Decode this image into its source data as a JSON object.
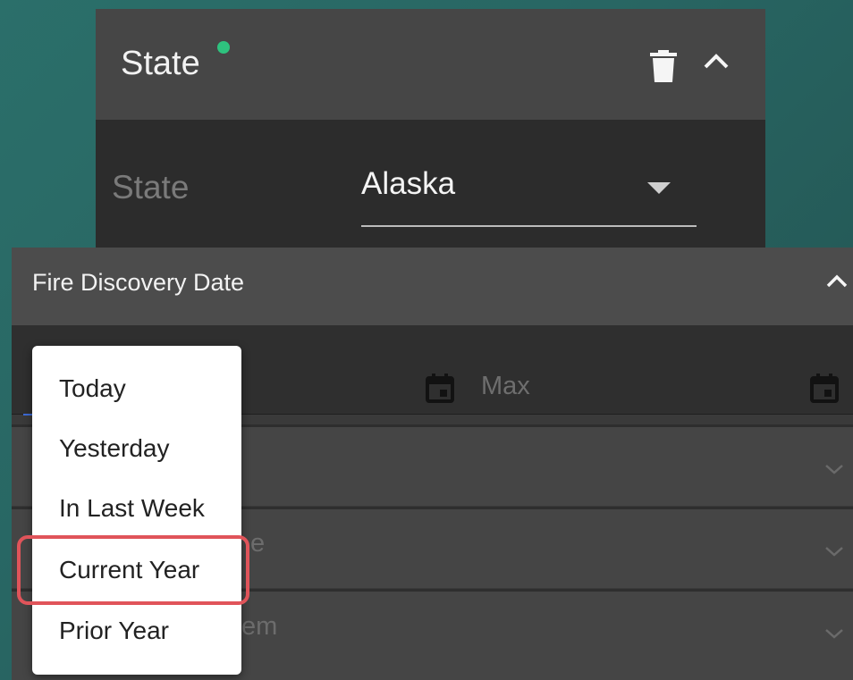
{
  "state_card": {
    "title": "State",
    "status_color": "#2ec27e",
    "field_label": "State",
    "selected_value": "Alaska"
  },
  "fire_panel": {
    "title": "Fire Discovery Date",
    "max_placeholder": "Max",
    "section2_partial": "e",
    "section3_partial": "em"
  },
  "menu": {
    "items": [
      "Today",
      "Yesterday",
      "In Last Week",
      "Current Year",
      "Prior Year"
    ],
    "highlighted_item": "Current Year",
    "highlight_color": "#e0545a"
  }
}
